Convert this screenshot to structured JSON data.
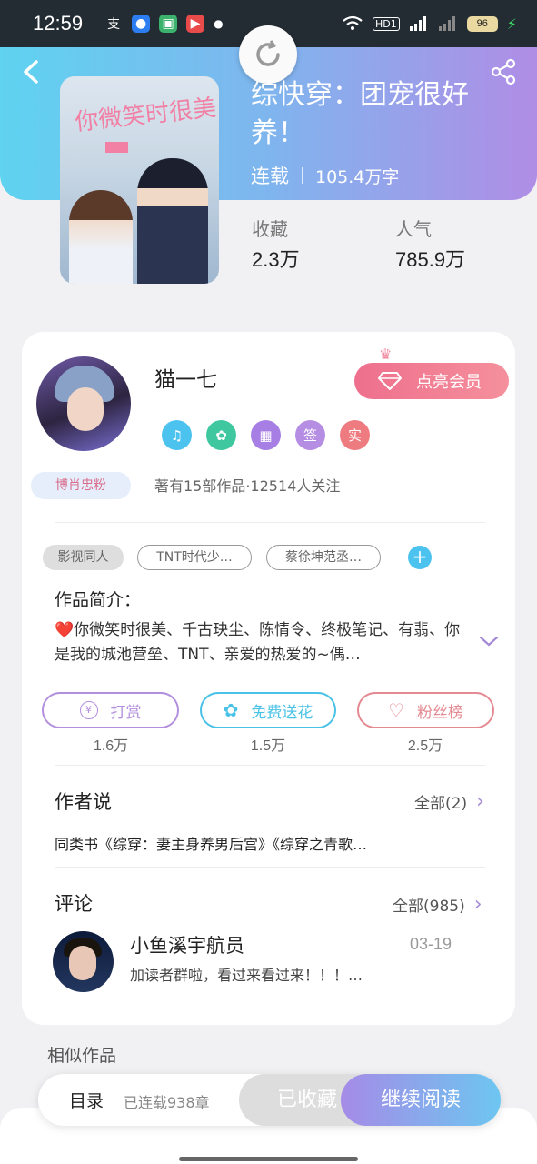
{
  "status_bar": {
    "time": "12:59",
    "battery": "96",
    "hd": "HD1",
    "network": "4G"
  },
  "book": {
    "title": "综快穿：团宠很好养！",
    "status": "连载",
    "word_count": "105.4万字",
    "stats": [
      {
        "label": "收藏",
        "value": "2.3万"
      },
      {
        "label": "人气",
        "value": "785.9万"
      }
    ],
    "cover_text": "你微笑时很美"
  },
  "author": {
    "name": "猫一七",
    "fan_badge": "博肖忠粉",
    "vip_button": "点亮会员",
    "info": "著有15部作品·12514人关注",
    "badges": [
      "签",
      "实"
    ]
  },
  "tags": {
    "type": "影视同人",
    "items": [
      "TNT时代少…",
      "蔡徐坤范丞…"
    ]
  },
  "intro": {
    "title": "作品简介：",
    "text": "❤️你微笑时很美、千古玦尘、陈情令、终极笔记、有翡、你是我的城池营垒、TNT、亲爱的热爱的~偶…"
  },
  "actions": [
    {
      "label": "打赏",
      "value": "1.6万",
      "color": "#b390dd"
    },
    {
      "label": "免费送花",
      "value": "1.5万",
      "color": "#49c2e6"
    },
    {
      "label": "粉丝榜",
      "value": "2.5万",
      "color": "#e48a92"
    }
  ],
  "author_says": {
    "title": "作者说",
    "more": "全部(2)",
    "text": "同类书《综穿：妻主身养男后宫》《综穿之青歌…"
  },
  "comments": {
    "title": "评论",
    "more": "全部(985)",
    "items": [
      {
        "user": "小鱼溪宇航员",
        "date": "03-19",
        "text": "加读者群啦，看过来看过来！！！…"
      }
    ]
  },
  "similar": {
    "title": "相似作品"
  },
  "bottom_bar": {
    "toc": "目录",
    "chapters": "已连载938章",
    "collected": "已收藏",
    "continue": "继续阅读"
  }
}
